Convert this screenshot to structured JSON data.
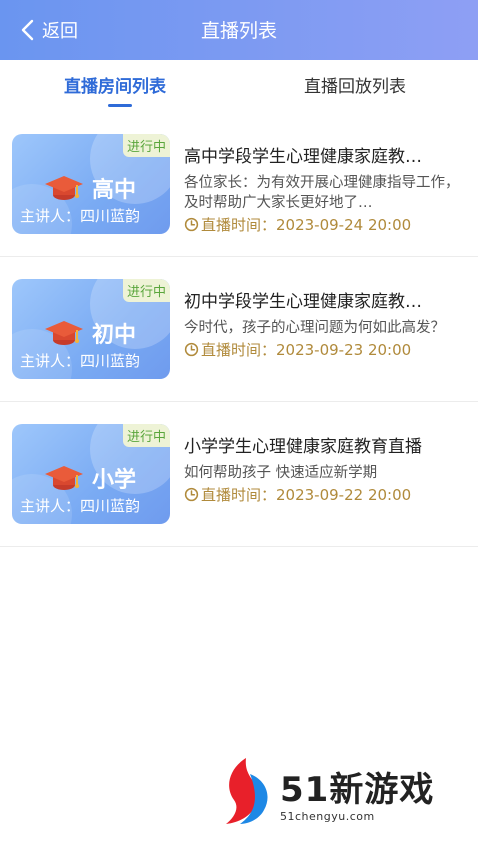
{
  "header": {
    "back_label": "返回",
    "title": "直播列表"
  },
  "tabs": [
    {
      "label": "直播房间列表",
      "active": true
    },
    {
      "label": "直播回放列表",
      "active": false
    }
  ],
  "items": [
    {
      "badge": "进行中",
      "grade": "高中",
      "speaker": "主讲人：四川蓝韵",
      "title": "高中学段学生心理健康家庭教…",
      "desc": "各位家长：为有效开展心理健康指导工作，及时帮助广大家长更好地了…",
      "time": "直播时间：2023-09-24 20:00"
    },
    {
      "badge": "进行中",
      "grade": "初中",
      "speaker": "主讲人：四川蓝韵",
      "title": "初中学段学生心理健康家庭教…",
      "desc": "今时代，孩子的心理问题为何如此高发？",
      "time": "直播时间：2023-09-23 20:00"
    },
    {
      "badge": "进行中",
      "grade": "小学",
      "speaker": "主讲人：四川蓝韵",
      "title": "小学学生心理健康家庭教育直播",
      "desc": "如何帮助孩子 快速适应新学期",
      "time": "直播时间：2023-09-22 20:00"
    }
  ],
  "watermark": {
    "brand": "51新游戏",
    "domain": "51chengyu.com"
  },
  "colors": {
    "header_start": "#6a95f0",
    "header_end": "#8e9ff4",
    "accent": "#2f6bd8",
    "time": "#b08a3b",
    "badge": "#5aa63c"
  },
  "icons": {
    "back": "chevron-left-icon",
    "cap": "graduation-cap-icon",
    "clock": "clock-icon"
  }
}
